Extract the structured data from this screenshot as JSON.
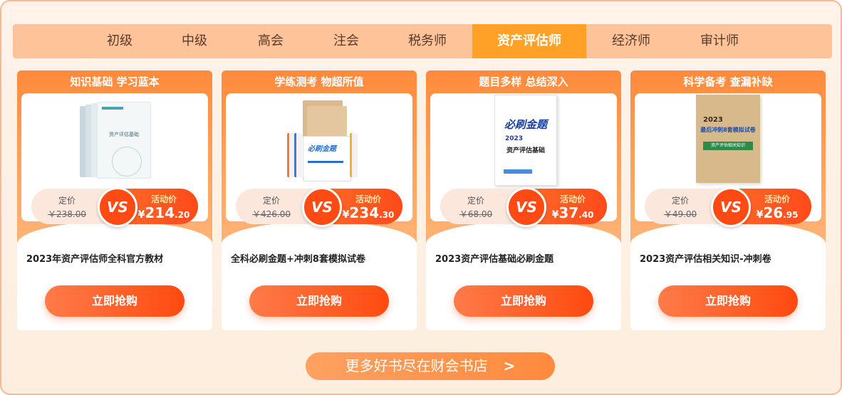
{
  "tabs": [
    {
      "label": "初级",
      "active": false
    },
    {
      "label": "中级",
      "active": false
    },
    {
      "label": "高会",
      "active": false
    },
    {
      "label": "注会",
      "active": false
    },
    {
      "label": "税务师",
      "active": false
    },
    {
      "label": "资产评估师",
      "active": true
    },
    {
      "label": "经济师",
      "active": false
    },
    {
      "label": "审计师",
      "active": false
    }
  ],
  "labels": {
    "orig": "定价",
    "sale": "活动价",
    "vs": "VS",
    "buy": "立即抢购",
    "yen": "¥"
  },
  "products": [
    {
      "header": "知识基础 学习蓝本",
      "orig_price": "￥238.00",
      "sale_int": "214",
      "sale_dec": ".20",
      "title": "2023年资产评估师全科官方教材",
      "cover_text": "资产评估基础"
    },
    {
      "header": "学练测考 物超所值",
      "orig_price": "￥426.00",
      "sale_int": "234",
      "sale_dec": ".30",
      "title": "全科必刷金题+冲刺8套模拟试卷",
      "cover_text": "必刷金题"
    },
    {
      "header": "题目多样 总结深入",
      "orig_price": "￥68.00",
      "sale_int": "37",
      "sale_dec": ".40",
      "title": "2023资产评估基础必刷金题",
      "cover_brand": "必刷金题",
      "cover_year": "2023",
      "cover_text": "资产评估基础"
    },
    {
      "header": "科学备考 查漏补缺",
      "orig_price": "￥49.00",
      "sale_int": "26",
      "sale_dec": ".95",
      "title": "2023资产评估相关知识-冲刺卷",
      "cover_year": "2023",
      "cover_title": "最后冲刺8套模拟试卷",
      "cover_text": "资产评估相关知识"
    }
  ],
  "more": {
    "label": "更多好书尽在财会书店",
    "arrow": ">"
  },
  "colors": {
    "tab_bar": "#ffc39a",
    "tab_active": "#ffa126",
    "card_orange": "#ff8a3c",
    "button_red": "#ff4a10"
  }
}
